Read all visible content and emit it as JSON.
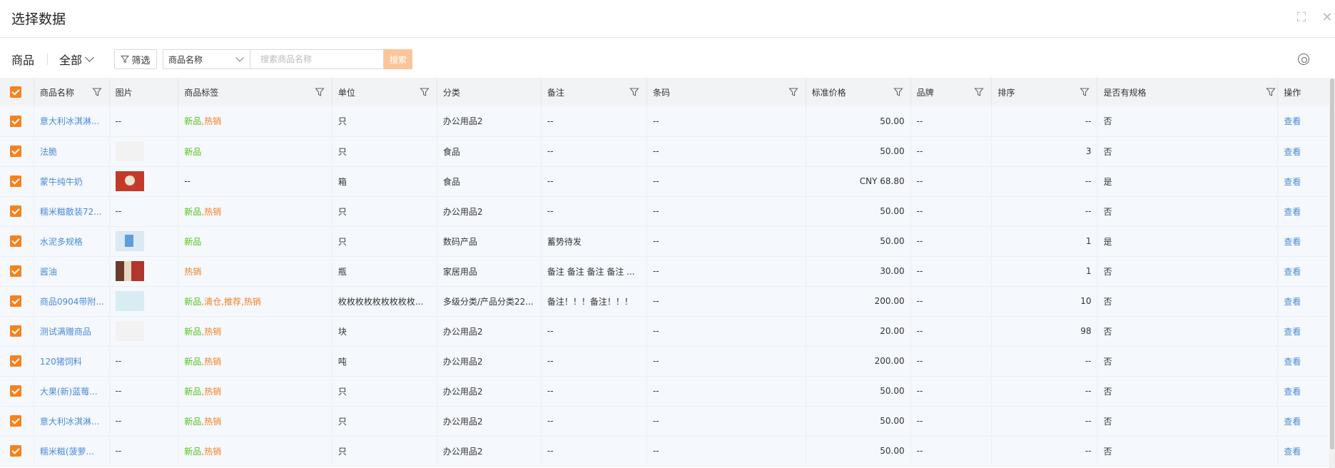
{
  "dialog": {
    "title": "选择数据",
    "fullscreen_icon": "fullscreen-icon",
    "close_icon": "close-icon"
  },
  "toolbar": {
    "module_label": "商品",
    "scope_label": "全部",
    "filter_label": "筛选",
    "search_field": "商品名称",
    "search_placeholder": "搜索商品名称",
    "search_button": "搜索"
  },
  "columns": [
    "商品名称",
    "图片",
    "商品标签",
    "单位",
    "分类",
    "备注",
    "条码",
    "标准价格",
    "品牌",
    "排序",
    "是否有规格",
    "操作"
  ],
  "colors": {
    "accent": "#f7811d",
    "link": "#4a8bd8",
    "tag_new": "#52c41a",
    "tag_hot": "#f57f23"
  },
  "rows": [
    {
      "name": "意大利冰淇淋...",
      "image": "--",
      "tags": [
        {
          "t": "新品",
          "c": "new"
        },
        {
          "t": "热销",
          "c": "hot"
        }
      ],
      "unit": "只",
      "category": "办公用品2",
      "remark": "--",
      "barcode": "--",
      "price": "50.00",
      "brand": "--",
      "sort": "--",
      "has_spec": "否",
      "action": "查看"
    },
    {
      "name": "法脆",
      "image": "empty",
      "tags": [
        {
          "t": "新品",
          "c": "new"
        }
      ],
      "unit": "只",
      "category": "食品",
      "remark": "--",
      "barcode": "--",
      "price": "50.00",
      "brand": "--",
      "sort": "3",
      "has_spec": "否",
      "action": "查看"
    },
    {
      "name": "蒙牛纯牛奶",
      "image": "milk",
      "tags": [
        {
          "t": "--",
          "c": "plain"
        }
      ],
      "unit": "箱",
      "category": "食品",
      "remark": "--",
      "barcode": "--",
      "price": "CNY 68.80",
      "brand": "--",
      "sort": "--",
      "has_spec": "是",
      "action": "查看"
    },
    {
      "name": "糯米糍散装72...",
      "image": "--",
      "tags": [
        {
          "t": "新品",
          "c": "new"
        },
        {
          "t": "热销",
          "c": "hot"
        }
      ],
      "unit": "只",
      "category": "办公用品2",
      "remark": "--",
      "barcode": "--",
      "price": "50.00",
      "brand": "--",
      "sort": "--",
      "has_spec": "否",
      "action": "查看"
    },
    {
      "name": "水泥多规格",
      "image": "cement",
      "tags": [
        {
          "t": "新品",
          "c": "new"
        }
      ],
      "unit": "只",
      "category": "数码产品",
      "remark": "蓄势待发",
      "barcode": "--",
      "price": "50.00",
      "brand": "--",
      "sort": "1",
      "has_spec": "是",
      "action": "查看"
    },
    {
      "name": "酱油",
      "image": "soy",
      "tags": [
        {
          "t": "热销",
          "c": "hot"
        }
      ],
      "unit": "瓶",
      "category": "家居用品",
      "remark": "备注 备注 备注 备注 ...",
      "barcode": "--",
      "price": "30.00",
      "brand": "--",
      "sort": "1",
      "has_spec": "否",
      "action": "查看"
    },
    {
      "name": "商品0904带附...",
      "image": "goods",
      "tags": [
        {
          "t": "新品",
          "c": "new"
        },
        {
          "t": "清仓",
          "c": "hot"
        },
        {
          "t": "推荐",
          "c": "hot"
        },
        {
          "t": "热销",
          "c": "hot"
        }
      ],
      "unit": "枚枚枚枚枚枚枚枚枚...",
      "category": "多级分类/产品分类22...",
      "remark": "备注！！！备注！！！",
      "barcode": "--",
      "price": "200.00",
      "brand": "--",
      "sort": "10",
      "has_spec": "否",
      "action": "查看"
    },
    {
      "name": "测试满赠商品",
      "image": "empty",
      "tags": [
        {
          "t": "新品",
          "c": "new"
        },
        {
          "t": "热销",
          "c": "hot"
        }
      ],
      "unit": "块",
      "category": "办公用品2",
      "remark": "--",
      "barcode": "--",
      "price": "20.00",
      "brand": "--",
      "sort": "98",
      "has_spec": "否",
      "action": "查看"
    },
    {
      "name": "120猪饲料",
      "image": "--",
      "tags": [
        {
          "t": "新品",
          "c": "new"
        },
        {
          "t": "热销",
          "c": "hot"
        }
      ],
      "unit": "吨",
      "category": "办公用品2",
      "remark": "--",
      "barcode": "--",
      "price": "200.00",
      "brand": "--",
      "sort": "--",
      "has_spec": "否",
      "action": "查看"
    },
    {
      "name": "大果(新)蓝莓...",
      "image": "--",
      "tags": [
        {
          "t": "新品",
          "c": "new"
        },
        {
          "t": "热销",
          "c": "hot"
        }
      ],
      "unit": "只",
      "category": "办公用品2",
      "remark": "--",
      "barcode": "--",
      "price": "50.00",
      "brand": "--",
      "sort": "--",
      "has_spec": "否",
      "action": "查看"
    },
    {
      "name": "意大利冰淇淋...",
      "image": "--",
      "tags": [
        {
          "t": "新品",
          "c": "new"
        },
        {
          "t": "热销",
          "c": "hot"
        }
      ],
      "unit": "只",
      "category": "办公用品2",
      "remark": "--",
      "barcode": "--",
      "price": "50.00",
      "brand": "--",
      "sort": "--",
      "has_spec": "否",
      "action": "查看"
    },
    {
      "name": "糯米糍(菠萝...",
      "image": "--",
      "tags": [
        {
          "t": "新品",
          "c": "new"
        },
        {
          "t": "热销",
          "c": "hot"
        }
      ],
      "unit": "只",
      "category": "办公用品2",
      "remark": "--",
      "barcode": "--",
      "price": "50.00",
      "brand": "--",
      "sort": "--",
      "has_spec": "否",
      "action": "查看"
    }
  ]
}
